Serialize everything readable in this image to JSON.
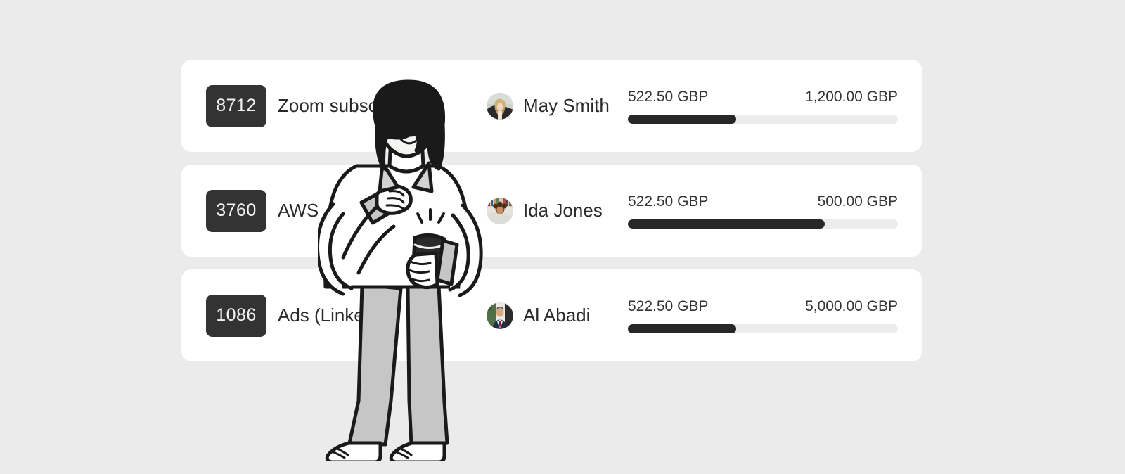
{
  "theme": {
    "page_background": "#ebebeb",
    "card_background": "#ffffff",
    "badge_background": "#333333",
    "badge_text_color": "#f2f2f2",
    "text_color": "#2a2a2a",
    "bar_fill_color": "#272727",
    "bar_track_color": "#ececec"
  },
  "list": {
    "rows": [
      {
        "code": "8712",
        "description": "Zoom subscription",
        "person": "May Smith",
        "avatar_icon": "avatar-photo-woman-blonde",
        "spent": "522.50 GBP",
        "budget": "1,200.00 GBP",
        "progress_percent": 40
      },
      {
        "code": "3760",
        "description": "AWS",
        "person": "Ida Jones",
        "avatar_icon": "avatar-photo-woman-curly",
        "spent": "522.50 GBP",
        "budget": "500.00 GBP",
        "progress_percent": 73
      },
      {
        "code": "1086",
        "description": "Ads (LinkedIn)",
        "person": "Al Abadi",
        "avatar_icon": "avatar-photo-man-suit",
        "spent": "522.50 GBP",
        "budget": "5,000.00 GBP",
        "progress_percent": 40
      }
    ]
  },
  "illustration": {
    "name": "woman-with-coffee-cup-line-art",
    "description": "Line-art illustration of a woman with a dark bob haircut, white collared shirt, grey wide-leg trousers and white sneakers, holding a dark coffee cup and pointing at it"
  }
}
